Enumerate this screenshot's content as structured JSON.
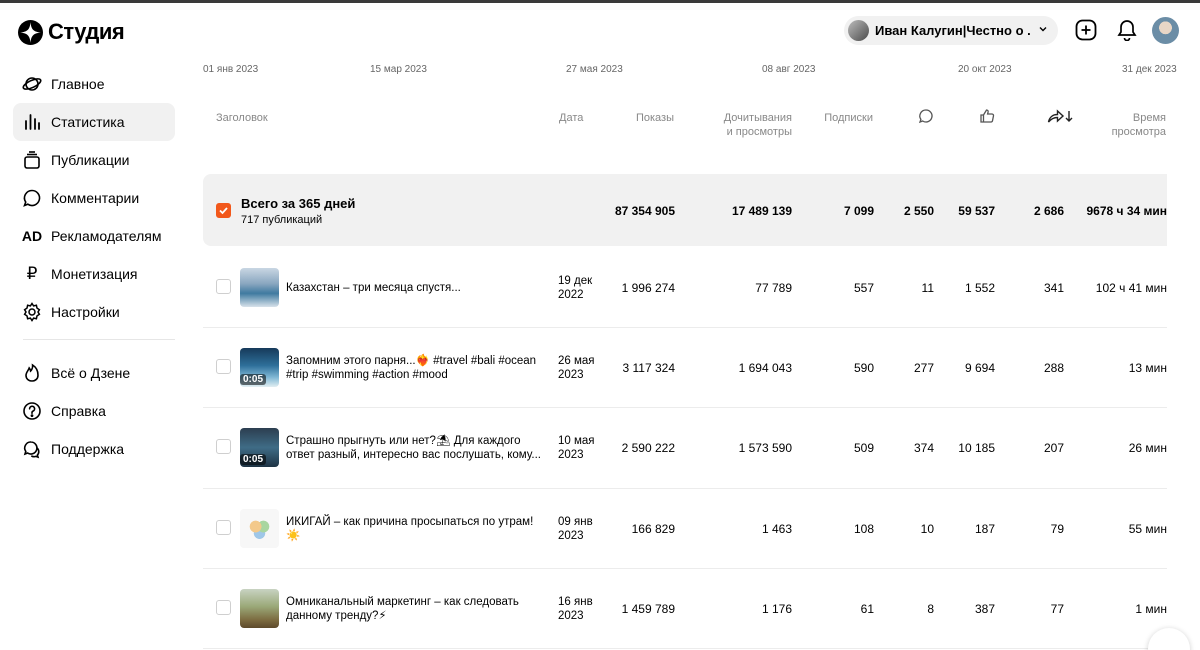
{
  "logo": {
    "text": "Студия"
  },
  "sidebar": {
    "items": [
      {
        "label": "Главное",
        "icon": "planet-icon"
      },
      {
        "label": "Статистика",
        "icon": "bar-chart-icon",
        "active": true
      },
      {
        "label": "Публикации",
        "icon": "stack-icon"
      },
      {
        "label": "Комментарии",
        "icon": "comment-icon"
      },
      {
        "label": "Рекламодателям",
        "icon": "ad-icon",
        "glyph": "AD"
      },
      {
        "label": "Монетизация",
        "icon": "ruble-icon",
        "glyph": "₽"
      },
      {
        "label": "Настройки",
        "icon": "gear-icon"
      }
    ],
    "secondary": [
      {
        "label": "Всё о Дзене",
        "icon": "flame-icon"
      },
      {
        "label": "Справка",
        "icon": "question-icon"
      },
      {
        "label": "Поддержка",
        "icon": "support-chat-icon"
      }
    ]
  },
  "header": {
    "channel_name": "Иван Калугин|Честно о ...",
    "icons": [
      "add-square-icon",
      "bell-icon",
      "avatar"
    ]
  },
  "timeline": {
    "dates": [
      "01 янв 2023",
      "15 мар 2023",
      "27 мая 2023",
      "08 авг 2023",
      "20 окт 2023",
      "31 дек 2023"
    ]
  },
  "table": {
    "headers": {
      "title": "Заголовок",
      "date": "Дата",
      "views": "Показы",
      "reads_line1": "Дочитывания",
      "reads_line2": "и просмотры",
      "subs": "Подписки",
      "comments_icon": "comment-icon",
      "likes_icon": "thumbs-up-icon",
      "shares_icon": "share-sort-icon",
      "time_line1": "Время",
      "time_line2": "просмотра"
    },
    "total": {
      "title": "Всего за 365 дней",
      "subtitle": "717 публикаций",
      "views": "87 354 905",
      "reads": "17 489 139",
      "subs": "7 099",
      "comments": "2 550",
      "likes": "59 537",
      "shares": "2 686",
      "time": "9678 ч 34 мин"
    },
    "rows": [
      {
        "title_l1": "Казахстан – три месяца спустя...",
        "title_l2": "",
        "date_l1": "19 дек",
        "date_l2": "2022",
        "duration": "",
        "views": "1 996 274",
        "reads": "77 789",
        "subs": "557",
        "comments": "11",
        "likes": "1 552",
        "shares": "341",
        "time": "102 ч 41 мин"
      },
      {
        "title_l1": "Запомним этого парня...❤️‍🔥 #travel #bali #ocean",
        "title_l2": "#trip #swimming #action #mood",
        "date_l1": "26 мая",
        "date_l2": "2023",
        "duration": "0:05",
        "views": "3 117 324",
        "reads": "1 694 043",
        "subs": "590",
        "comments": "277",
        "likes": "9 694",
        "shares": "288",
        "time": "13 мин"
      },
      {
        "title_l1": "Страшно прыгнуть или нет?⛱ Для каждого",
        "title_l2": "ответ разный, интересно вас послушать, кому...",
        "date_l1": "10 мая",
        "date_l2": "2023",
        "duration": "0:05",
        "views": "2 590 222",
        "reads": "1 573 590",
        "subs": "509",
        "comments": "374",
        "likes": "10 185",
        "shares": "207",
        "time": "26 мин"
      },
      {
        "title_l1": "ИКИГАЙ – как причина просыпаться по утрам!",
        "title_l2": "☀️",
        "date_l1": "09 янв",
        "date_l2": "2023",
        "duration": "",
        "views": "166 829",
        "reads": "1 463",
        "subs": "108",
        "comments": "10",
        "likes": "187",
        "shares": "79",
        "time": "55 мин"
      },
      {
        "title_l1": "Омниканальный маркетинг – как следовать",
        "title_l2": "данному тренду?⚡",
        "date_l1": "16 янв",
        "date_l2": "2023",
        "duration": "",
        "views": "1 459 789",
        "reads": "1 176",
        "subs": "61",
        "comments": "8",
        "likes": "387",
        "shares": "77",
        "time": "1 мин"
      }
    ]
  },
  "colors": {
    "accent": "#f2581b",
    "active_bg": "#f1f1f1"
  }
}
